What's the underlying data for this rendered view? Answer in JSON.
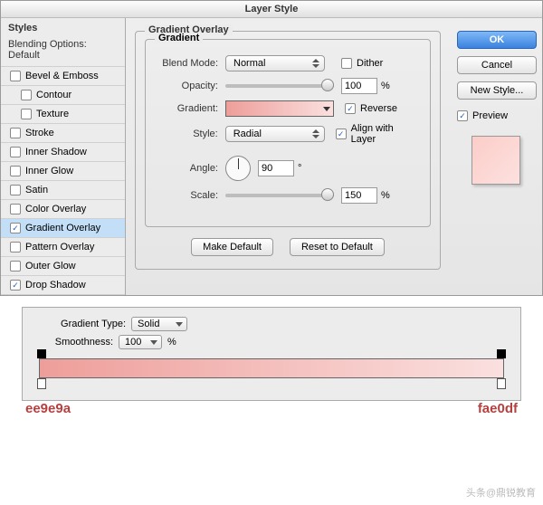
{
  "window": {
    "title": "Layer Style"
  },
  "sidebar": {
    "header": "Styles",
    "subheader": "Blending Options: Default",
    "items": [
      {
        "label": "Bevel & Emboss",
        "checked": false,
        "selected": false,
        "sub": false
      },
      {
        "label": "Contour",
        "checked": false,
        "selected": false,
        "sub": true
      },
      {
        "label": "Texture",
        "checked": false,
        "selected": false,
        "sub": true
      },
      {
        "label": "Stroke",
        "checked": false,
        "selected": false,
        "sub": false
      },
      {
        "label": "Inner Shadow",
        "checked": false,
        "selected": false,
        "sub": false
      },
      {
        "label": "Inner Glow",
        "checked": false,
        "selected": false,
        "sub": false
      },
      {
        "label": "Satin",
        "checked": false,
        "selected": false,
        "sub": false
      },
      {
        "label": "Color Overlay",
        "checked": false,
        "selected": false,
        "sub": false
      },
      {
        "label": "Gradient Overlay",
        "checked": true,
        "selected": true,
        "sub": false
      },
      {
        "label": "Pattern Overlay",
        "checked": false,
        "selected": false,
        "sub": false
      },
      {
        "label": "Outer Glow",
        "checked": false,
        "selected": false,
        "sub": false
      },
      {
        "label": "Drop Shadow",
        "checked": true,
        "selected": false,
        "sub": false
      }
    ]
  },
  "panel": {
    "group_title": "Gradient Overlay",
    "subgroup_title": "Gradient",
    "blend_mode_label": "Blend Mode:",
    "blend_mode_value": "Normal",
    "dither_label": "Dither",
    "dither_checked": false,
    "opacity_label": "Opacity:",
    "opacity_value": "100",
    "percent": "%",
    "gradient_label": "Gradient:",
    "reverse_label": "Reverse",
    "reverse_checked": true,
    "style_label": "Style:",
    "style_value": "Radial",
    "align_label": "Align with Layer",
    "align_checked": true,
    "angle_label": "Angle:",
    "angle_value": "90",
    "degree": "°",
    "scale_label": "Scale:",
    "scale_value": "150",
    "make_default": "Make Default",
    "reset_default": "Reset to Default"
  },
  "buttons": {
    "ok": "OK",
    "cancel": "Cancel",
    "new_style": "New Style...",
    "preview": "Preview"
  },
  "editor": {
    "type_label": "Gradient Type:",
    "type_value": "Solid",
    "smooth_label": "Smoothness:",
    "smooth_value": "100",
    "percent": "%",
    "left_hex": "ee9e9a",
    "right_hex": "fae0df"
  },
  "watermark": "头条@鼎锐教育"
}
